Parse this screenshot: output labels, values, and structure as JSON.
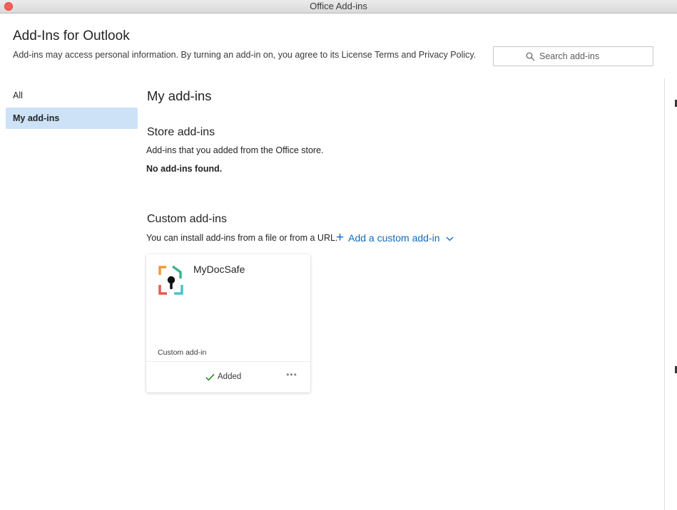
{
  "window": {
    "title": "Office Add-ins"
  },
  "header": {
    "title": "Add-Ins for Outlook",
    "description": "Add-ins may access personal information. By turning an add-in on, you agree to its License Terms and Privacy Policy."
  },
  "search": {
    "placeholder": "Search add-ins",
    "value": "",
    "icon": "search-icon"
  },
  "sidebar": {
    "items": [
      {
        "label": "All",
        "selected": false
      },
      {
        "label": "My add-ins",
        "selected": true
      }
    ],
    "selected_color": "#cde2f6"
  },
  "main": {
    "title": "My add-ins",
    "store": {
      "title": "Store add-ins",
      "description": "Add-ins that you added from the Office store.",
      "empty_text": "No add-ins found."
    },
    "custom": {
      "title": "Custom add-ins",
      "description": "You can install add-ins from a file or from a URL.",
      "add_label": "Add a custom add-in",
      "add_icon": "plus-icon",
      "dropdown_icon": "chevron-down-icon",
      "link_color": "#0f6cbd"
    },
    "cards": [
      {
        "name": "MyDocSafe",
        "type": "Custom add-in",
        "status": "Added",
        "status_icon": "checkmark-icon",
        "status_color": "#107c10",
        "more_label": "•••"
      }
    ]
  }
}
